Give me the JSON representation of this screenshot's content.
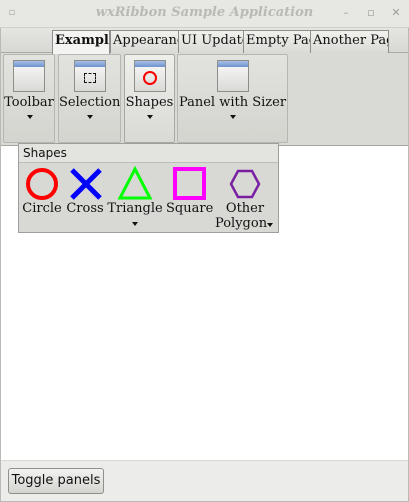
{
  "window": {
    "title": "wxRibbon Sample Application",
    "menu_glyph": "▫",
    "minimize_glyph": "–",
    "maximize_glyph": "▫",
    "close_glyph": "✕"
  },
  "tabs": [
    {
      "label": "Examples",
      "active": true
    },
    {
      "label": "Appearance",
      "active": false
    },
    {
      "label": "UI Updated",
      "active": false
    },
    {
      "label": "Empty Page",
      "active": false
    },
    {
      "label": "Another Page",
      "active": false
    }
  ],
  "ribbon_panels": [
    {
      "label": "Toolbar",
      "has_dropdown": true
    },
    {
      "label": "Selection",
      "has_dropdown": true
    },
    {
      "label": "Shapes",
      "has_dropdown": true,
      "expanded": true
    },
    {
      "label": "Panel with Sizer",
      "has_dropdown": true
    }
  ],
  "shapes_popup": {
    "title": "Shapes",
    "buttons": [
      {
        "label": "Circle",
        "icon": "circle-icon",
        "color": "#ff0000"
      },
      {
        "label": "Cross",
        "icon": "cross-icon",
        "color": "#0000ff"
      },
      {
        "label": "Triangle",
        "icon": "triangle-icon",
        "color": "#00ff00",
        "has_dropdown": true
      },
      {
        "label": "Square",
        "icon": "square-icon",
        "color": "#ff00ff"
      },
      {
        "label": "Other",
        "label2": "Polygon",
        "icon": "hexagon-icon",
        "color": "#7a1fa2",
        "has_dropdown": true
      }
    ]
  },
  "bottom": {
    "toggle_label": "Toggle panels"
  },
  "colors": {
    "tab_bar": "#6f93cf",
    "circle": "#ff0000",
    "cross": "#0000ff",
    "triangle": "#00ff00",
    "square": "#ff00ff",
    "hexagon": "#7a1fa2"
  }
}
